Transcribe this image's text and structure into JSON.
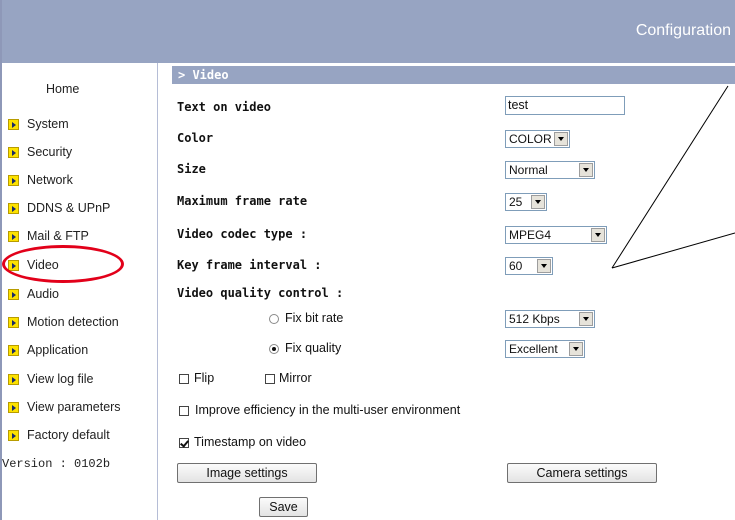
{
  "header": {
    "title": "Configuration"
  },
  "sidebar": {
    "home": "Home",
    "items": [
      {
        "label": "System"
      },
      {
        "label": "Security"
      },
      {
        "label": "Network"
      },
      {
        "label": "DDNS & UPnP"
      },
      {
        "label": "Mail & FTP"
      },
      {
        "label": "Video"
      },
      {
        "label": "Audio"
      },
      {
        "label": "Motion detection"
      },
      {
        "label": "Application"
      },
      {
        "label": "View log file"
      },
      {
        "label": "View parameters"
      },
      {
        "label": "Factory default"
      }
    ],
    "version": "Version : 0102b",
    "highlight_color": "#e2001a"
  },
  "section": {
    "title": "> Video"
  },
  "form": {
    "text_on_video": {
      "label": "Text on video",
      "value": "test"
    },
    "color": {
      "label": "Color",
      "value": "COLOR"
    },
    "size": {
      "label": "Size",
      "value": "Normal"
    },
    "max_frame_rate": {
      "label": "Maximum frame rate",
      "value": "25"
    },
    "codec": {
      "label": "Video codec type :",
      "value": "MPEG4"
    },
    "key_frame": {
      "label": "Key frame interval :",
      "value": "60"
    },
    "quality_control": {
      "label": "Video quality control :",
      "fix_bit_rate": {
        "label": "Fix bit rate",
        "checked": false,
        "value": "512 Kbps"
      },
      "fix_quality": {
        "label": "Fix quality",
        "checked": true,
        "value": "Excellent"
      }
    },
    "flip": {
      "label": "Flip",
      "checked": false
    },
    "mirror": {
      "label": "Mirror",
      "checked": false
    },
    "multi_user": {
      "label": "Improve efficiency in the multi-user environment",
      "checked": false
    },
    "timestamp": {
      "label": "Timestamp on video",
      "checked": true
    }
  },
  "buttons": {
    "image_settings": "Image settings",
    "camera_settings": "Camera settings",
    "save": "Save"
  },
  "colors": {
    "banner": "#97a4c2",
    "accent_arrow": "#fde200"
  }
}
